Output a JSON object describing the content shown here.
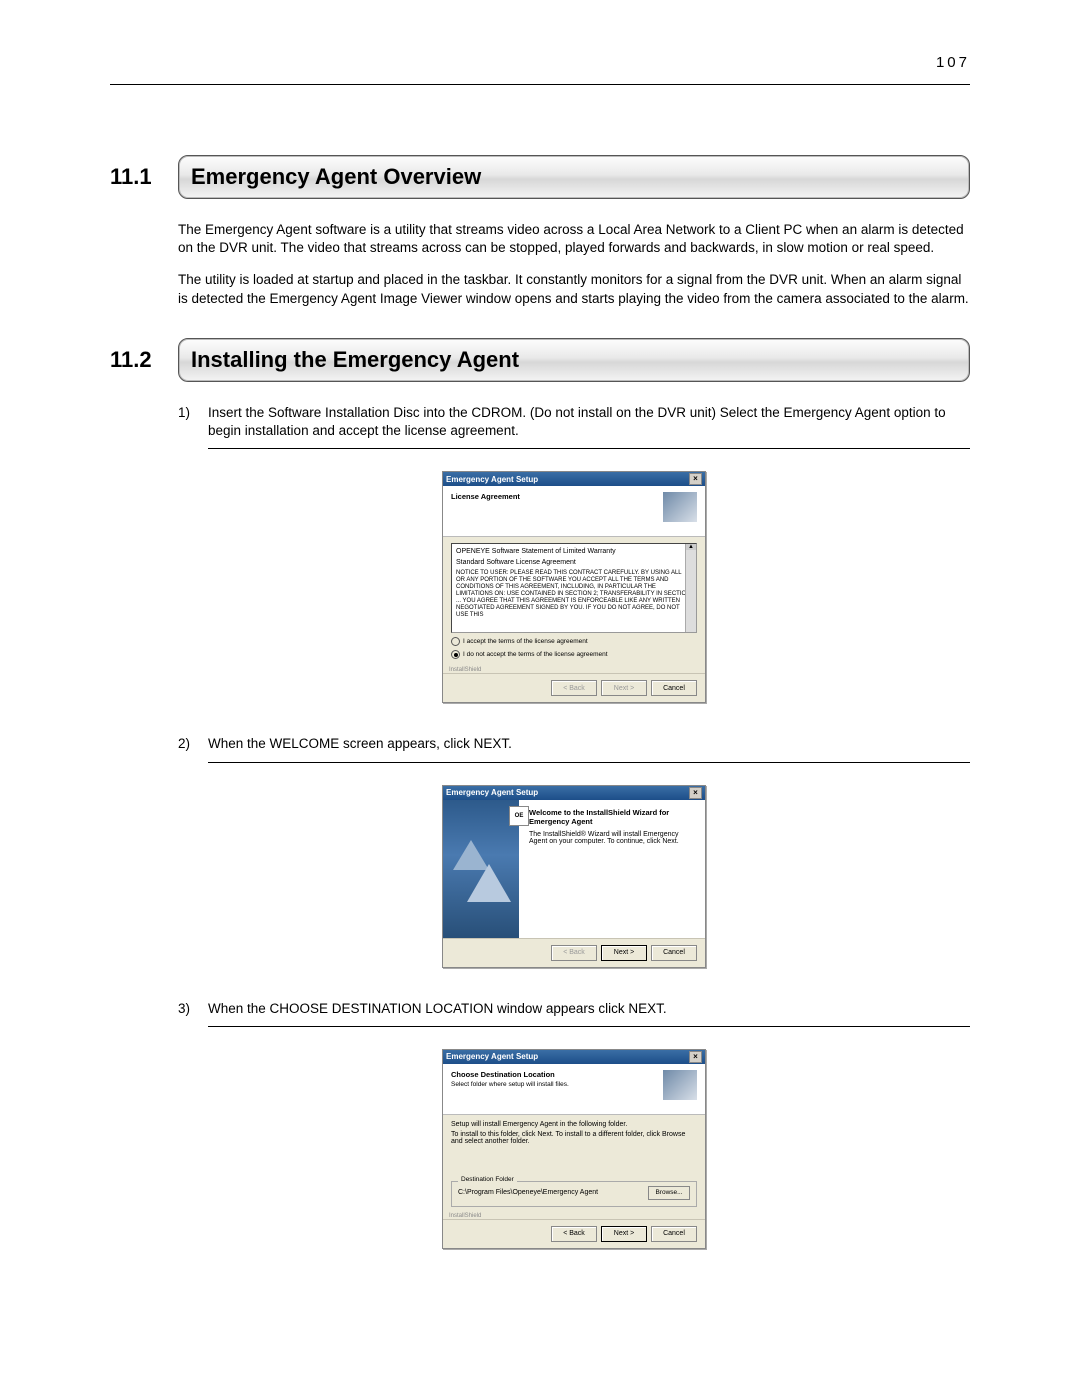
{
  "page_number": "107",
  "sections": [
    {
      "number": "11.1",
      "title": "Emergency Agent Overview",
      "paragraphs": [
        "The Emergency Agent software is a utility that streams video across a Local Area Network to a Client PC when an alarm is detected on the DVR unit. The video that streams across can be stopped, played forwards and backwards, in slow motion or real speed.",
        "The utility is loaded at startup and placed in the taskbar. It constantly monitors for a signal from the DVR unit. When an alarm signal is detected the Emergency Agent Image Viewer window opens and starts playing the video from the camera associated to the alarm."
      ]
    },
    {
      "number": "11.2",
      "title": "Installing the Emergency Agent"
    }
  ],
  "steps": [
    {
      "num": "1)",
      "text": "Insert the Software Installation Disc into the CDROM. (Do not install on the DVR unit) Select the Emergency Agent option to begin installation and accept the license agreement."
    },
    {
      "num": "2)",
      "text": "When the WELCOME screen appears, click NEXT."
    },
    {
      "num": "3)",
      "text": "When the CHOOSE DESTINATION LOCATION window appears click NEXT."
    }
  ],
  "installer1": {
    "title": "Emergency Agent Setup",
    "header_bold": "License Agreement",
    "box_line1": "OPENEYE Software Statement of Limited Warranty",
    "box_line2": "Standard Software License Agreement",
    "box_body": "NOTICE TO USER: PLEASE READ THIS CONTRACT CAREFULLY. BY USING ALL OR ANY PORTION OF THE SOFTWARE YOU ACCEPT ALL THE TERMS AND CONDITIONS OF THIS AGREEMENT, INCLUDING, IN PARTICULAR THE LIMITATIONS ON: USE CONTAINED IN SECTION 2; TRANSFERABILITY IN SECTION ... YOU AGREE THAT THIS AGREEMENT IS ENFORCEABLE LIKE ANY WRITTEN NEGOTIATED AGREEMENT SIGNED BY YOU. IF YOU DO NOT AGREE, DO NOT USE THIS",
    "radio_accept": "I accept the terms of the license agreement",
    "radio_reject": "I do not accept the terms of the license agreement",
    "brand": "InstallShield",
    "btn_back": "< Back",
    "btn_next": "Next >",
    "btn_cancel": "Cancel"
  },
  "installer2": {
    "title": "Emergency Agent Setup",
    "side_logo": "OE",
    "welcome_bold": "Welcome to the InstallShield Wizard for Emergency Agent",
    "welcome_body": "The InstallShield® Wizard will install Emergency Agent on your computer. To continue, click Next.",
    "btn_back": "< Back",
    "btn_next": "Next >",
    "btn_cancel": "Cancel"
  },
  "installer3": {
    "title": "Emergency Agent Setup",
    "header_bold": "Choose Destination Location",
    "header_sub": "Select folder where setup will install files.",
    "body_line1": "Setup will install Emergency Agent in the following folder.",
    "body_line2": "To install to this folder, click Next. To install to a different folder, click Browse and select another folder.",
    "fieldset_legend": "Destination Folder",
    "path": "C:\\Program Files\\Openeye\\Emergency Agent",
    "browse": "Browse...",
    "brand": "InstallShield",
    "btn_back": "< Back",
    "btn_next": "Next >",
    "btn_cancel": "Cancel"
  }
}
